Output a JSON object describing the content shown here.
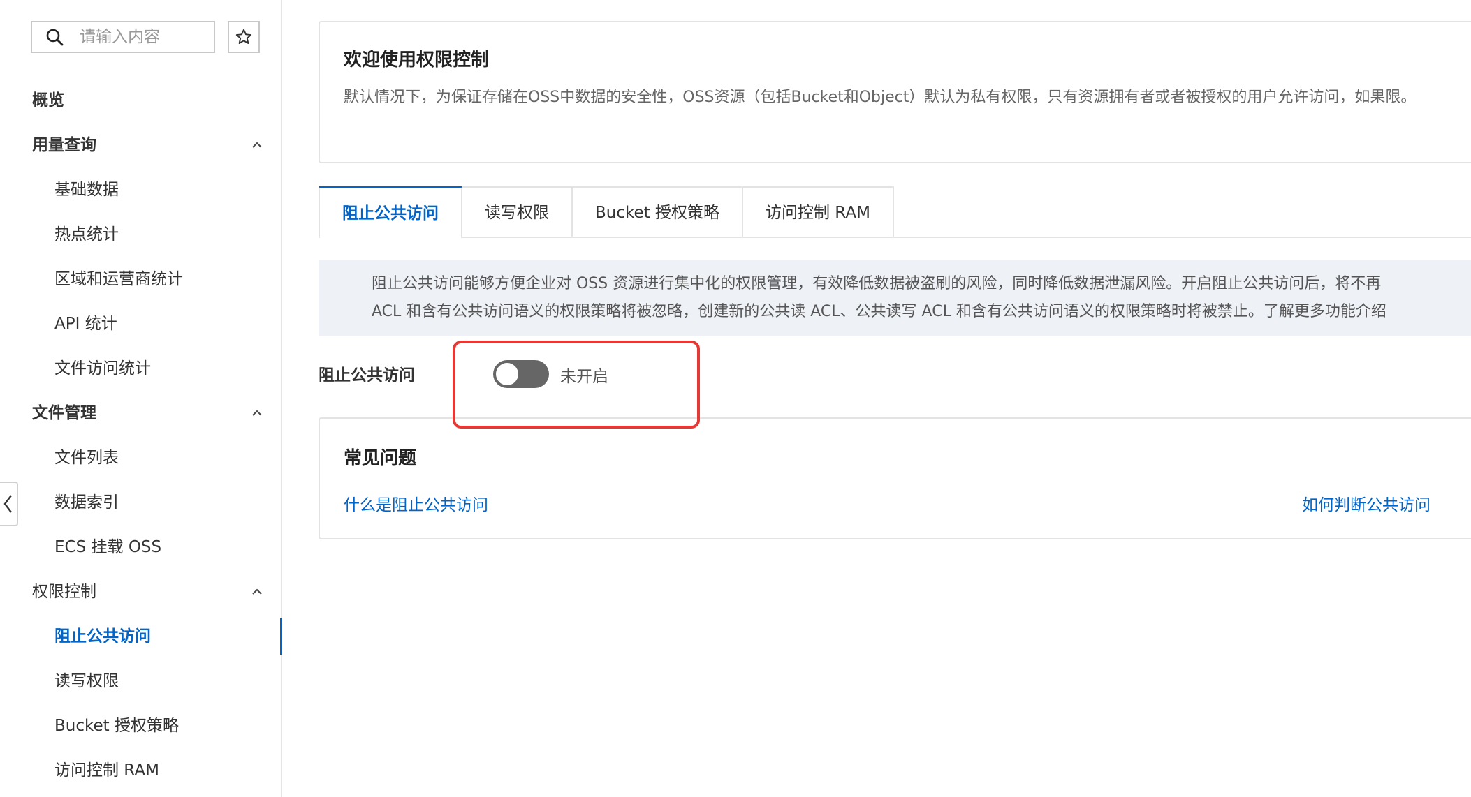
{
  "sidebar": {
    "search_placeholder": "请输入内容",
    "items": [
      {
        "label": "概览"
      },
      {
        "label": "用量查询"
      },
      {
        "label": "基础数据"
      },
      {
        "label": "热点统计"
      },
      {
        "label": "区域和运营商统计"
      },
      {
        "label": "API 统计"
      },
      {
        "label": "文件访问统计"
      },
      {
        "label": "文件管理"
      },
      {
        "label": "文件列表"
      },
      {
        "label": "数据索引"
      },
      {
        "label": "ECS 挂载 OSS"
      },
      {
        "label": "权限控制"
      },
      {
        "label": "阻止公共访问"
      },
      {
        "label": "读写权限"
      },
      {
        "label": "Bucket 授权策略"
      },
      {
        "label": "访问控制 RAM"
      }
    ]
  },
  "welcome": {
    "title": "欢迎使用权限控制",
    "description": "默认情况下，为保证存储在OSS中数据的安全性，OSS资源（包括Bucket和Object）默认为私有权限，只有资源拥有者或者被授权的用户允许访问，如果限。"
  },
  "tabs": [
    {
      "label": "阻止公共访问"
    },
    {
      "label": "读写权限"
    },
    {
      "label": "Bucket 授权策略"
    },
    {
      "label": "访问控制 RAM"
    }
  ],
  "notice": {
    "line1": "阻止公共访问能够方便企业对 OSS 资源进行集中化的权限管理，有效降低数据被盗刷的风险，同时降低数据泄漏风险。开启阻止公共访问后，将不再",
    "line2": "ACL 和含有公共访问语义的权限策略将被忽略，创建新的公共读 ACL、公共读写 ACL 和含有公共访问语义的权限策略时将被禁止。了解更多功能介绍"
  },
  "block_public_access": {
    "label": "阻止公共访问",
    "enabled": false,
    "state_text": "未开启"
  },
  "faq": {
    "title": "常见问题",
    "links": [
      {
        "label": "什么是阻止公共访问"
      },
      {
        "label": "如何判断公共访问"
      }
    ]
  },
  "colors": {
    "accent": "#0064c8",
    "highlight": "#e53935",
    "switch_off": "#666666",
    "notice_bg": "#eef1f6"
  }
}
